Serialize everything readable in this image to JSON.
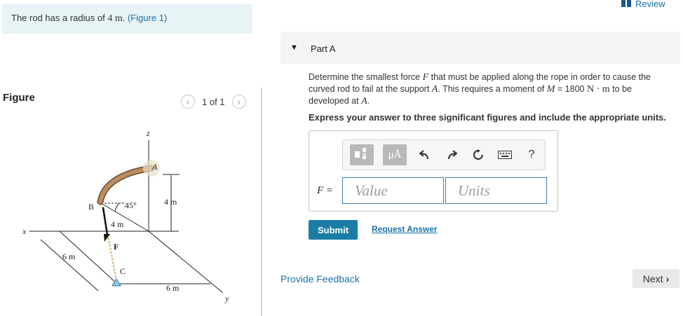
{
  "problem": {
    "text_before": "The rod has a radius of ",
    "radius_value": "4 m",
    "text_after": ". ",
    "figure_link": "(Figure 1)"
  },
  "figure": {
    "label": "Figure",
    "pager": "1 of 1",
    "labels": {
      "z": "z",
      "x": "x",
      "y": "y",
      "A": "A",
      "B": "B",
      "C": "C",
      "F": "F",
      "angle": "45°",
      "radius": "4 m",
      "height": "4 m",
      "side_x": "6 m",
      "side_y": "6 m"
    }
  },
  "header": {
    "review": "Review"
  },
  "part": {
    "title": "Part A",
    "q_line1_a": "Determine the smallest force ",
    "q_F": "F",
    "q_line1_b": " that must be applied along the rope in order to cause the",
    "q_line2_a": "curved rod to fail at the support ",
    "q_A": "A",
    "q_line2_b": ". This requires a moment of ",
    "q_M": "M",
    "q_line2_c": " = 1800 ",
    "q_unit": "N · m",
    "q_line2_d": " to be",
    "q_line3_a": "developed at ",
    "q_line3_b": ".",
    "instruction": "Express your answer to three significant figures and include the appropriate units."
  },
  "answer": {
    "toolbar": {
      "units_button": "μÅ",
      "help": "?"
    },
    "variable_label": "F =",
    "value_placeholder": "Value",
    "units_placeholder": "Units"
  },
  "actions": {
    "submit": "Submit",
    "request_answer": "Request Answer",
    "feedback": "Provide Feedback",
    "next": "Next"
  },
  "colors": {
    "accent": "#1a7da6",
    "link": "#1a73a8",
    "rod_fill": "#b98c62",
    "toolbar_btn": "#b9b9b9"
  }
}
